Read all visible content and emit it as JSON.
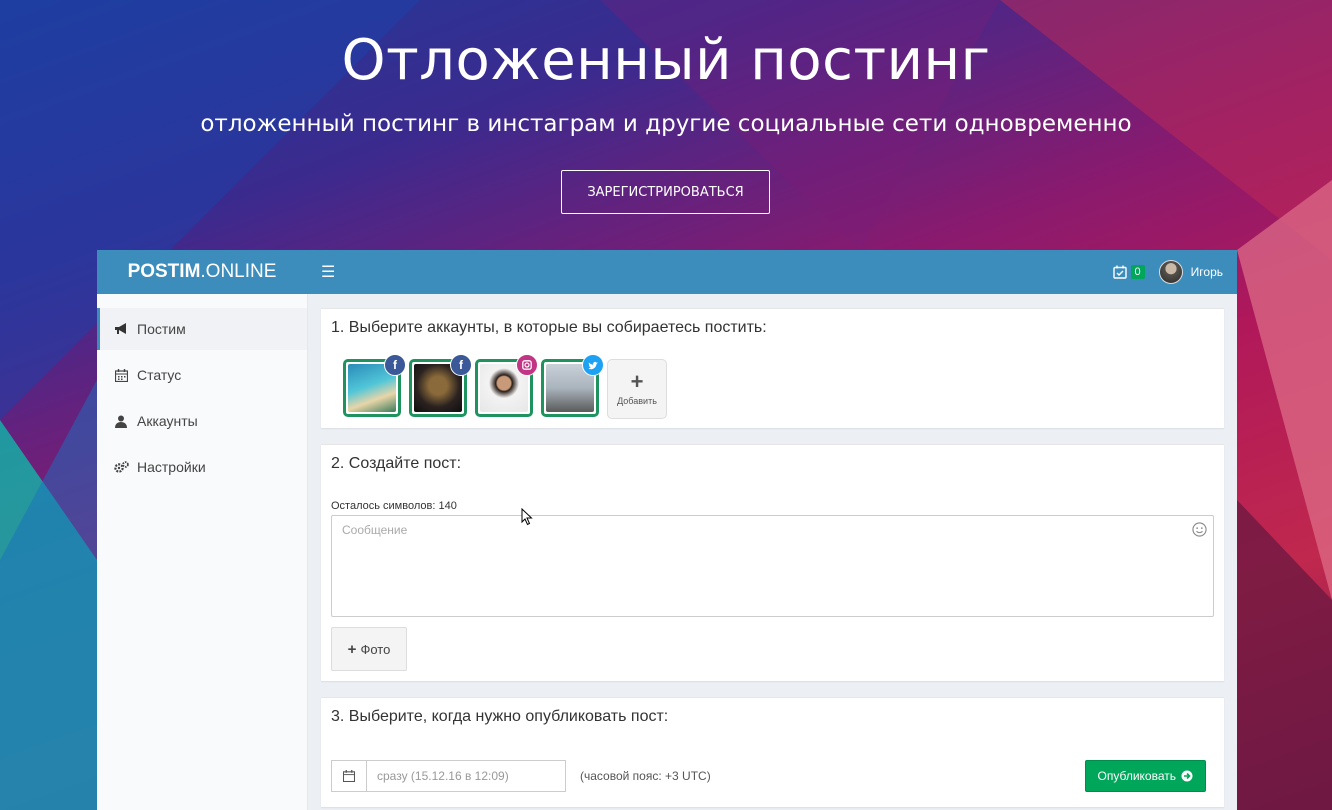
{
  "hero": {
    "title": "Отложенный постинг",
    "subtitle": "отложенный постинг в инстаграм и другие социальные сети одновременно",
    "register_label": "ЗАРЕГИСТРИРОВАТЬСЯ"
  },
  "app": {
    "logo_bold": "POSTIM",
    "logo_rest": ".ONLINE",
    "notifications_count": "0",
    "user_name": "Игорь",
    "colors": {
      "header": "#3c8dbc",
      "accent_green": "#00a65a",
      "account_border": "#1e9360"
    }
  },
  "sidebar": {
    "items": [
      {
        "label": "Постим",
        "icon": "megaphone-icon",
        "active": true
      },
      {
        "label": "Статус",
        "icon": "calendar-icon",
        "active": false
      },
      {
        "label": "Аккаунты",
        "icon": "user-icon",
        "active": false
      },
      {
        "label": "Настройки",
        "icon": "cogs-icon",
        "active": false
      }
    ]
  },
  "step1": {
    "title": "1. Выберите аккаунты, в которые вы собираетесь постить:",
    "accounts": [
      {
        "network": "facebook",
        "icon": "facebook-icon",
        "color": "#3b5998"
      },
      {
        "network": "facebook",
        "icon": "facebook-icon",
        "color": "#3b5998"
      },
      {
        "network": "instagram",
        "icon": "instagram-icon",
        "color": "#c13584"
      },
      {
        "network": "twitter",
        "icon": "twitter-icon",
        "color": "#1da1f2"
      }
    ],
    "add_label": "Добавить"
  },
  "step2": {
    "title": "2. Создайте пост:",
    "counter": "Осталось символов: 140",
    "message_placeholder": "Сообщение",
    "photo_label": "Фото"
  },
  "step3": {
    "title": "3. Выберите, когда нужно опубликовать пост:",
    "date_placeholder": "сразу (15.12.16 в 12:09)",
    "timezone": "(часовой пояс: +3 UTC)",
    "publish_label": "Опубликовать"
  }
}
